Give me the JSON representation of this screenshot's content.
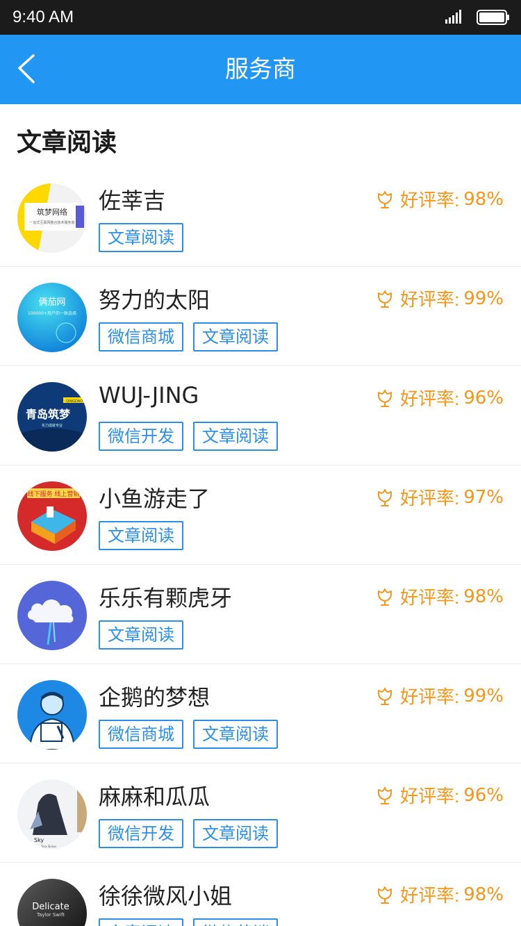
{
  "status_bar": {
    "time": "9:40 AM"
  },
  "nav": {
    "title": "服务商"
  },
  "section": {
    "title": "文章阅读"
  },
  "rating_prefix": "好评率:",
  "avatars": [
    {
      "text": "筑梦网络",
      "subtext": "一站式互联网整合技术服务商"
    },
    {
      "text": "俩茄网",
      "subtext": "100000+用户的一致选择"
    },
    {
      "text": "青岛筑梦",
      "subtext": "实力成就专业",
      "badge": "QINGDAO"
    },
    {
      "text": "线下服务 线上营销"
    },
    {
      "text": ""
    },
    {
      "text": ""
    },
    {
      "text": "Sky",
      "subtext": "Tina Skikes"
    },
    {
      "text": "Delicate",
      "subtext": "Taylor Swift"
    }
  ],
  "providers": [
    {
      "name": "佐莘吉",
      "rating": "98%",
      "tags": [
        "文章阅读"
      ]
    },
    {
      "name": "努力的太阳",
      "rating": "99%",
      "tags": [
        "微信商城",
        "文章阅读"
      ]
    },
    {
      "name": "WUJ-JING",
      "rating": "96%",
      "tags": [
        "微信开发",
        "文章阅读"
      ]
    },
    {
      "name": "小鱼游走了",
      "rating": "97%",
      "tags": [
        "文章阅读"
      ]
    },
    {
      "name": "乐乐有颗虎牙",
      "rating": "98%",
      "tags": [
        "文章阅读"
      ]
    },
    {
      "name": "企鹅的梦想",
      "rating": "99%",
      "tags": [
        "微信商城",
        "文章阅读"
      ]
    },
    {
      "name": "麻麻和瓜瓜",
      "rating": "96%",
      "tags": [
        "微信开发",
        "文章阅读"
      ]
    },
    {
      "name": "徐徐微风小姐",
      "rating": "98%",
      "tags": [
        "文章阅读",
        "微信营销"
      ]
    }
  ],
  "colors": {
    "primary": "#2196f3",
    "tag": "#2c8ee8",
    "rating": "#f59619"
  }
}
